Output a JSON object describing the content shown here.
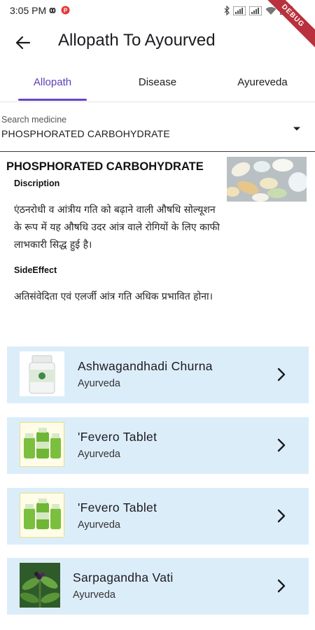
{
  "status": {
    "time": "3:05 PM",
    "debug": "DEBUG"
  },
  "app_bar": {
    "title": "Allopath To Ayourved"
  },
  "tabs": [
    {
      "label": "Allopath",
      "active": true
    },
    {
      "label": "Disease",
      "active": false
    },
    {
      "label": "Ayureveda",
      "active": false
    }
  ],
  "search": {
    "label": "Search medicine",
    "value": "PHOSPHORATED CARBOHYDRATE"
  },
  "medicine": {
    "name": "PHOSPHORATED CARBOHYDRATE",
    "description_label": "Discription",
    "description": "एंठनरोधी व आंत्रीय गति को बढ़ाने वाली औषधि सोल्यूशन के रूप में यह औषधि उदर आंत्र वाले रोगियों के लिए काफी लाभकारी सिद्ध हुई है।",
    "side_effect_label": "SideEffect",
    "side_effect": "अतिसंवेदिता एवं एलर्जी आंत्र गति अधिक प्रभावित होना।"
  },
  "results": [
    {
      "name": "Ashwagandhadi Churna",
      "category": "Ayurveda",
      "thumb": "bottle-icon"
    },
    {
      "name": "'Fevero Tablet",
      "category": "Ayurveda",
      "thumb": "bottles-icon"
    },
    {
      "name": "'Fevero Tablet",
      "category": "Ayurveda",
      "thumb": "bottles-icon"
    },
    {
      "name": "Sarpagandha Vati",
      "category": "Ayurveda",
      "thumb": "plant-icon"
    }
  ],
  "colors": {
    "accent": "#6a45c2",
    "card_bg": "#dcedfa",
    "debug": "#b8313c"
  }
}
